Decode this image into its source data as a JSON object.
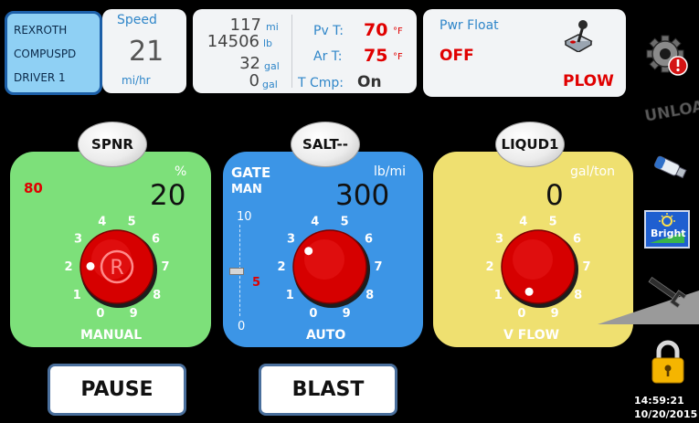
{
  "driver": {
    "line1": "REXROTH",
    "line2": "COMPUSPD",
    "line3": "DRIVER 1"
  },
  "speed": {
    "label": "Speed",
    "value": "21",
    "unit": "mi/hr"
  },
  "totals": {
    "distance": "117",
    "distance_unit": "mi",
    "weight": "14506",
    "weight_unit": "lb",
    "volume": "32",
    "volume_unit": "gal",
    "volume2": "0",
    "volume2_unit": "gal"
  },
  "temps": {
    "pv_label": "Pv T:",
    "pv_value": "70",
    "pv_unit": "°F",
    "ar_label": "Ar T:",
    "ar_value": "75",
    "ar_unit": "°F",
    "cmp_label": "T Cmp:",
    "cmp_value": "On"
  },
  "pwr": {
    "label": "Pwr Float",
    "state": "OFF",
    "mode": "PLOW"
  },
  "spinner": {
    "tag": "SPNR",
    "alarm": "80",
    "unit": "%",
    "value": "20",
    "mode": "MANUAL",
    "dial_level": 2,
    "dial_numbers": [
      "0",
      "1",
      "2",
      "3",
      "4",
      "5",
      "6",
      "7",
      "8",
      "9"
    ]
  },
  "salt": {
    "tag": "SALT--",
    "gate_label": "GATE",
    "man_label": "MAN",
    "unit": "lb/mi",
    "value": "300",
    "mode": "AUTO",
    "dial_level": 3,
    "gate_scale_top": "10",
    "gate_scale_bottom": "0",
    "gate_value": "5",
    "gate_level": 0.5,
    "dial_numbers": [
      "0",
      "1",
      "2",
      "3",
      "4",
      "5",
      "6",
      "7",
      "8",
      "9"
    ]
  },
  "liquid": {
    "tag": "LIQUD1",
    "unit": "gal/ton",
    "value": "0",
    "mode": "V FLOW",
    "dial_level": 0,
    "dial_numbers": [
      "0",
      "1",
      "2",
      "3",
      "4",
      "5",
      "6",
      "7",
      "8",
      "9"
    ]
  },
  "buttons": {
    "pause": "PAUSE",
    "blast": "BLAST"
  },
  "sidebar": {
    "unload": "UNLOAD",
    "bright": "Bright"
  },
  "clock": {
    "time": "14:59:21",
    "date": "10/20/2015"
  },
  "colors": {
    "spinner_panel": "#7de07a",
    "salt_panel": "#3c95e6",
    "liquid_panel": "#efe070",
    "knob_red": "#d60000",
    "alarm_red": "#e00000"
  }
}
